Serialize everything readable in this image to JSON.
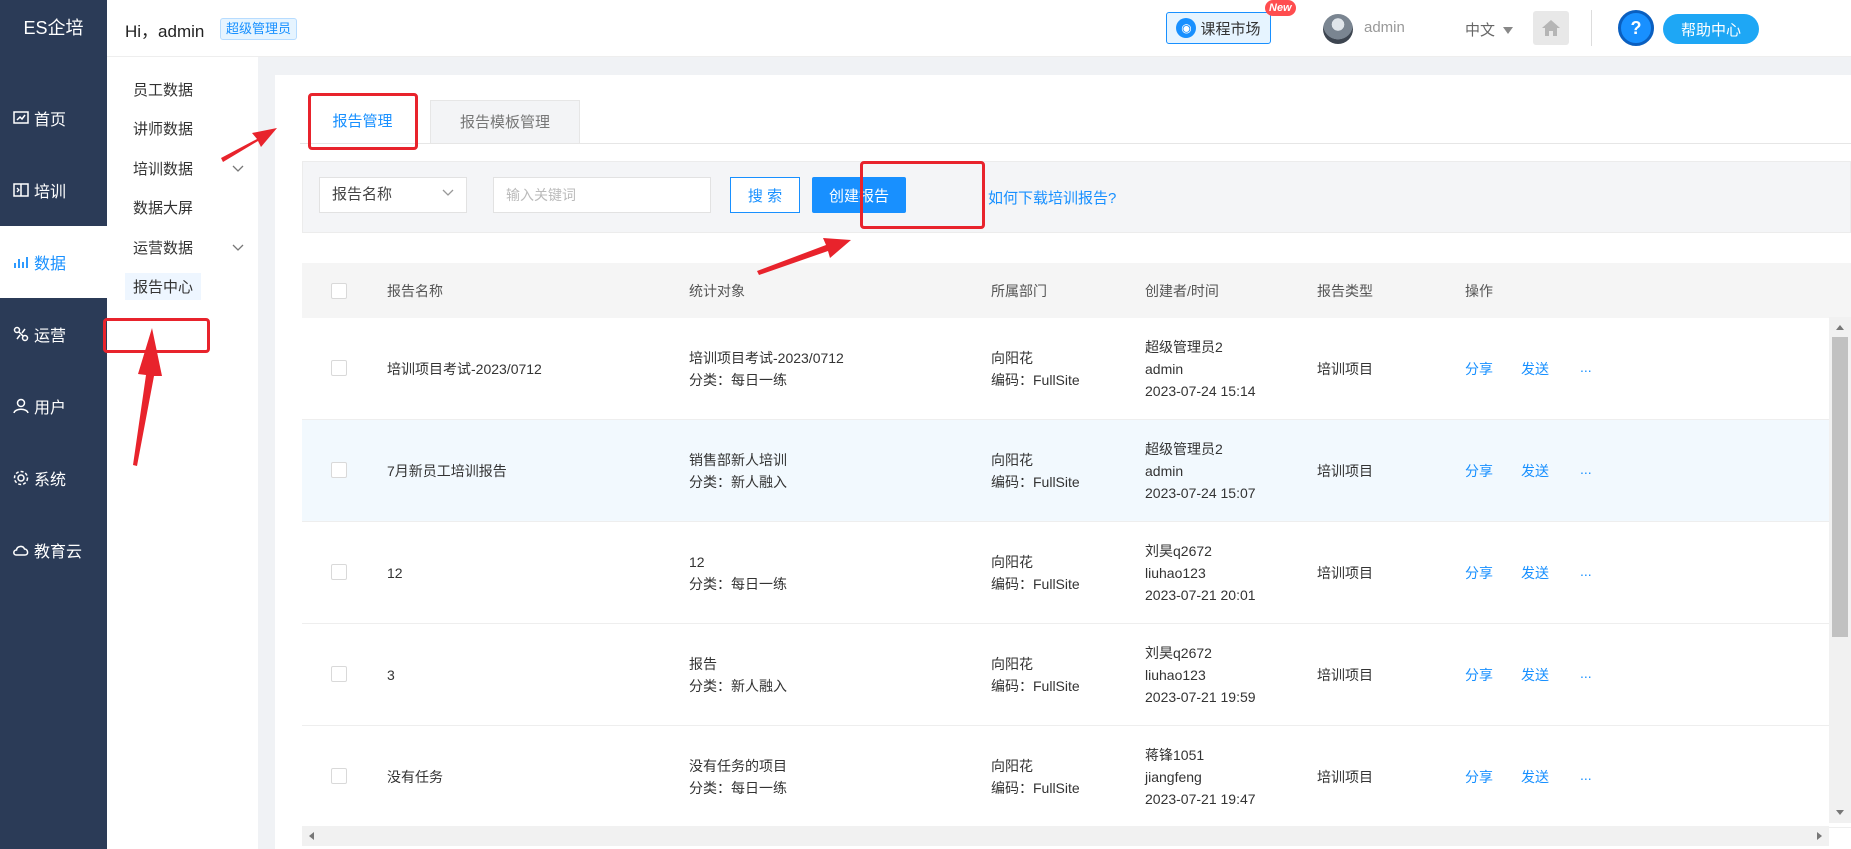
{
  "brand": "ES企培",
  "nav": [
    {
      "label": "首页",
      "icon": "dashboard-icon",
      "active": false
    },
    {
      "label": "培训",
      "icon": "training-icon",
      "active": false
    },
    {
      "label": "数据",
      "icon": "data-chart-icon",
      "active": true
    },
    {
      "label": "运营",
      "icon": "operation-icon",
      "active": false
    },
    {
      "label": "用户",
      "icon": "user-icon",
      "active": false
    },
    {
      "label": "系统",
      "icon": "gear-icon",
      "active": false
    },
    {
      "label": "教育云",
      "icon": "cloud-icon",
      "active": false
    }
  ],
  "header": {
    "greeting": "Hi，admin",
    "role": "超级管理员",
    "market": "课程市场",
    "new_tag": "New",
    "user": "admin",
    "lang": "中文",
    "help": "帮助中心",
    "help_q": "?"
  },
  "subnav": [
    {
      "label": "员工数据",
      "has_children": false
    },
    {
      "label": "讲师数据",
      "has_children": false
    },
    {
      "label": "培训数据",
      "has_children": true
    },
    {
      "label": "数据大屏",
      "has_children": false
    },
    {
      "label": "运营数据",
      "has_children": true
    },
    {
      "label": "报告中心",
      "has_children": false,
      "current": true
    }
  ],
  "tabs": [
    "报告管理",
    "报告模板管理"
  ],
  "filter": {
    "select_value": "报告名称",
    "placeholder": "输入关键词",
    "search": "搜 索",
    "create": "创建报告",
    "help_link": "如何下载培训报告?"
  },
  "table": {
    "columns": [
      "报告名称",
      "统计对象",
      "所属部门",
      "创建者/时间",
      "报告类型",
      "操作"
    ],
    "rows": [
      {
        "name": "培训项目考试-2023/0712",
        "target": "培训项目考试-2023/0712",
        "category": "分类：每日一练",
        "dept": "向阳花",
        "code": "编码：FullSite",
        "creator": "超级管理员2",
        "account": "admin",
        "time": "2023-07-24 15:14",
        "type": "培训项目"
      },
      {
        "name": "7月新员工培训报告",
        "target": "销售部新人培训",
        "category": "分类：新人融入",
        "dept": "向阳花",
        "code": "编码：FullSite",
        "creator": "超级管理员2",
        "account": "admin",
        "time": "2023-07-24 15:07",
        "type": "培训项目"
      },
      {
        "name": "12",
        "target": "12",
        "category": "分类：每日一练",
        "dept": "向阳花",
        "code": "编码：FullSite",
        "creator": "刘昊q2672",
        "account": "liuhao123",
        "time": "2023-07-21 20:01",
        "type": "培训项目"
      },
      {
        "name": "3",
        "target": "报告",
        "category": "分类：新人融入",
        "dept": "向阳花",
        "code": "编码：FullSite",
        "creator": "刘昊q2672",
        "account": "liuhao123",
        "time": "2023-07-21 19:59",
        "type": "培训项目"
      },
      {
        "name": "没有任务",
        "target": "没有任务的项目",
        "category": "分类：每日一练",
        "dept": "向阳花",
        "code": "编码：FullSite",
        "creator": "蒋锋1051",
        "account": "jiangfeng",
        "time": "2023-07-21 19:47",
        "type": "培训项目"
      }
    ],
    "actions": [
      "分享",
      "发送",
      "..."
    ]
  },
  "colors": {
    "sidebar": "#2b3b57",
    "accent": "#1890ff",
    "annotation": "#e8232c"
  }
}
